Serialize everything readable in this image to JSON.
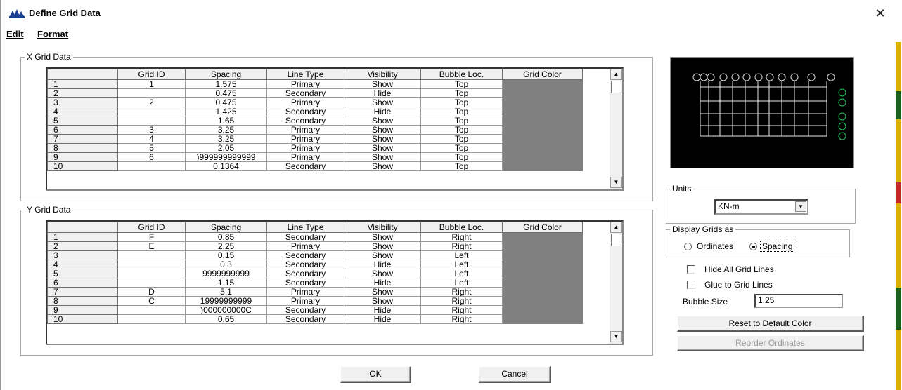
{
  "window": {
    "title": "Define Grid Data",
    "close_glyph": "✕"
  },
  "menu": {
    "edit": "Edit",
    "format": "Format"
  },
  "x_grid": {
    "label": "X Grid Data",
    "headers": [
      "",
      "Grid ID",
      "Spacing",
      "Line Type",
      "Visibility",
      "Bubble Loc.",
      "Grid Color"
    ],
    "rows": [
      [
        "1",
        "1",
        "1.575",
        "Primary",
        "Show",
        "Top"
      ],
      [
        "2",
        "",
        "0.475",
        "Secondary",
        "Hide",
        "Top"
      ],
      [
        "3",
        "2",
        "0.475",
        "Primary",
        "Show",
        "Top"
      ],
      [
        "4",
        "",
        "1.425",
        "Secondary",
        "Hide",
        "Top"
      ],
      [
        "5",
        "",
        "1.65",
        "Secondary",
        "Show",
        "Top"
      ],
      [
        "6",
        "3",
        "3.25",
        "Primary",
        "Show",
        "Top"
      ],
      [
        "7",
        "4",
        "3.25",
        "Primary",
        "Show",
        "Top"
      ],
      [
        "8",
        "5",
        "2.05",
        "Primary",
        "Show",
        "Top"
      ],
      [
        "9",
        "6",
        ")999999999999",
        "Primary",
        "Show",
        "Top"
      ],
      [
        "10",
        "",
        "0.1364",
        "Secondary",
        "Show",
        "Top"
      ]
    ]
  },
  "y_grid": {
    "label": "Y Grid Data",
    "headers": [
      "",
      "Grid ID",
      "Spacing",
      "Line Type",
      "Visibility",
      "Bubble Loc.",
      "Grid Color"
    ],
    "rows": [
      [
        "1",
        "F",
        "0.85",
        "Secondary",
        "Show",
        "Right"
      ],
      [
        "2",
        "E",
        "2.25",
        "Primary",
        "Show",
        "Right"
      ],
      [
        "3",
        "",
        "0.15",
        "Secondary",
        "Show",
        "Left"
      ],
      [
        "4",
        "",
        "0.3",
        "Secondary",
        "Hide",
        "Left"
      ],
      [
        "5",
        "",
        "9999999999",
        "Secondary",
        "Show",
        "Left"
      ],
      [
        "6",
        "",
        "1.15",
        "Secondary",
        "Hide",
        "Left"
      ],
      [
        "7",
        "D",
        "5.1",
        "Primary",
        "Show",
        "Right"
      ],
      [
        "8",
        "C",
        "19999999999",
        "Primary",
        "Show",
        "Right"
      ],
      [
        "9",
        "",
        ")000000000C",
        "Secondary",
        "Hide",
        "Right"
      ],
      [
        "10",
        "",
        "0.65",
        "Secondary",
        "Hide",
        "Right"
      ]
    ]
  },
  "units": {
    "label": "Units",
    "value": "KN-m"
  },
  "display_grids": {
    "label": "Display Grids as",
    "ordinates": "Ordinates",
    "spacing": "Spacing",
    "selected": "spacing"
  },
  "hide_all_grid_lines": "Hide All Grid Lines",
  "glue_to_grid_lines": "Glue to Grid Lines",
  "bubble_size": {
    "label": "Bubble Size",
    "value": "1.25"
  },
  "buttons": {
    "reset_color": "Reset to Default Color",
    "reorder": "Reorder Ordinates",
    "ok": "OK",
    "cancel": "Cancel"
  },
  "colors": {
    "grid_color_cell": "#808080",
    "preview_bg": "#000000",
    "bubble_x": "#dcdcdc",
    "bubble_y": "#22c55e"
  }
}
